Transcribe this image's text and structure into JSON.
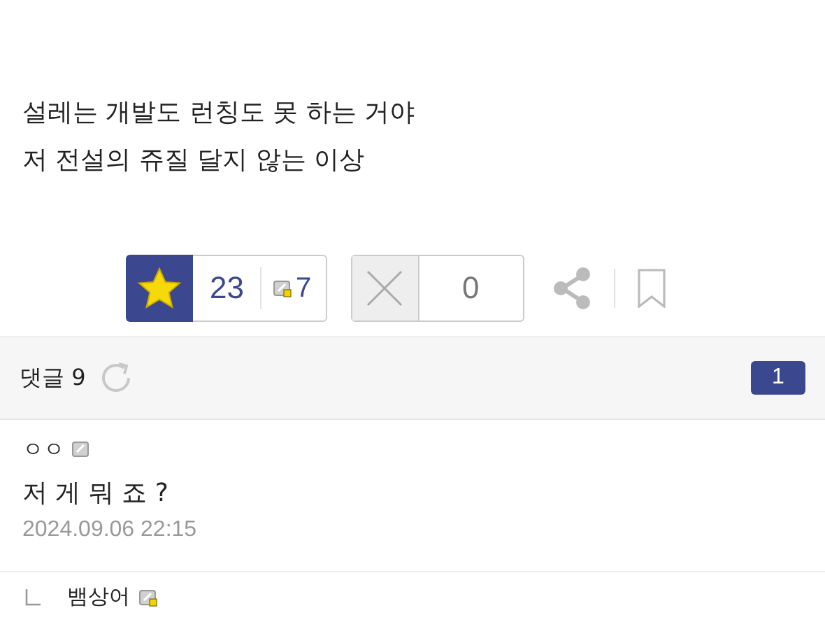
{
  "post_body": [
    "설레는 개발도 런칭도 못 하는 거야",
    "저 전설의 쥬질 달지 않는 이상"
  ],
  "votes": {
    "up_count": "23",
    "fixed_up_count": "7",
    "down_count": "0"
  },
  "comments_header": {
    "label": "댓글 9",
    "page": "1"
  },
  "comments": [
    {
      "author": "ㅇㅇ",
      "kind": "floating",
      "text": "저 게 뭐 죠 ?",
      "time": "2024.09.06 22:15"
    }
  ],
  "reply": {
    "author": "뱀상어",
    "kind": "fixed"
  }
}
